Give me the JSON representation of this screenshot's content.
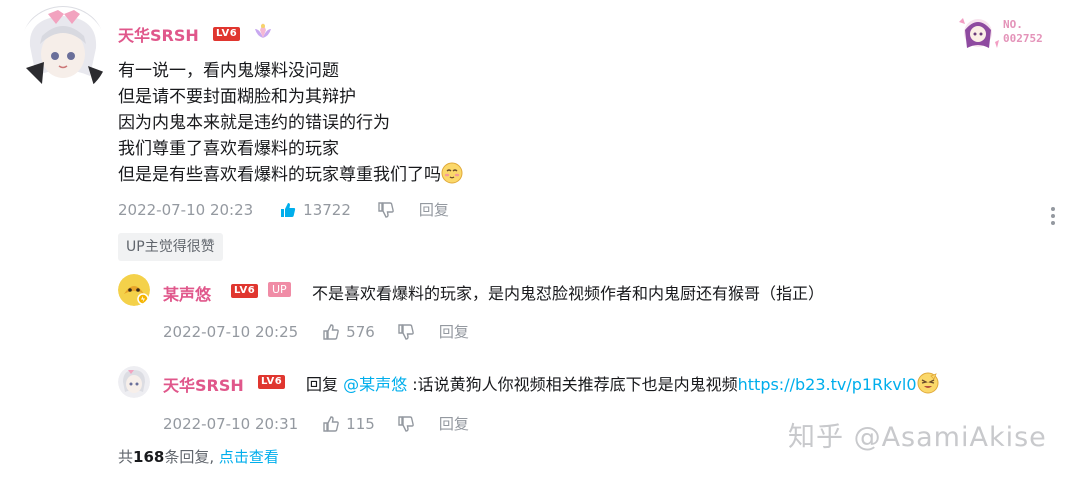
{
  "main_comment": {
    "username": "天华SRSH",
    "level": "LV6",
    "lines": [
      "有一说一，看内鬼爆料没问题",
      "但是请不要封面糊脸和为其辩护",
      "因为内鬼本来就是违约的错误的行为",
      "我们尊重了喜欢看爆料的玩家",
      "但是是有些喜欢看爆料的玩家尊重我们了吗"
    ],
    "timestamp": "2022-07-10 20:23",
    "likes": "13722",
    "reply_label": "回复",
    "up_liked": "UP主觉得很赞",
    "nft_no_label": "NO.",
    "nft_no_value": "002752"
  },
  "replies": [
    {
      "username": "某声悠",
      "level": "LV6",
      "badge": "UP",
      "text": "不是喜欢看爆料的玩家，是内鬼怼脸视频作者和内鬼厨还有猴哥（指正）",
      "timestamp": "2022-07-10 20:25",
      "likes": "576",
      "reply_label": "回复"
    },
    {
      "username": "天华SRSH",
      "level": "LV6",
      "reply_prefix": "回复",
      "mention": "@某声悠",
      "text": ":话说黄狗人你视频相关推荐底下也是内鬼视频",
      "link": "https://b23.tv/p1Rkvl0",
      "timestamp": "2022-07-10 20:31",
      "likes": "115",
      "reply_label": "回复"
    }
  ],
  "footer": {
    "prefix": "共",
    "count": "168",
    "suffix": "条回复,",
    "view_link": "点击查看"
  },
  "watermark": "知乎 @AsamiAkise",
  "colors": {
    "username_pink": "#e0578b",
    "link_blue": "#00aeec",
    "level_red": "#e0362f",
    "meta_gray": "#9499a0"
  }
}
